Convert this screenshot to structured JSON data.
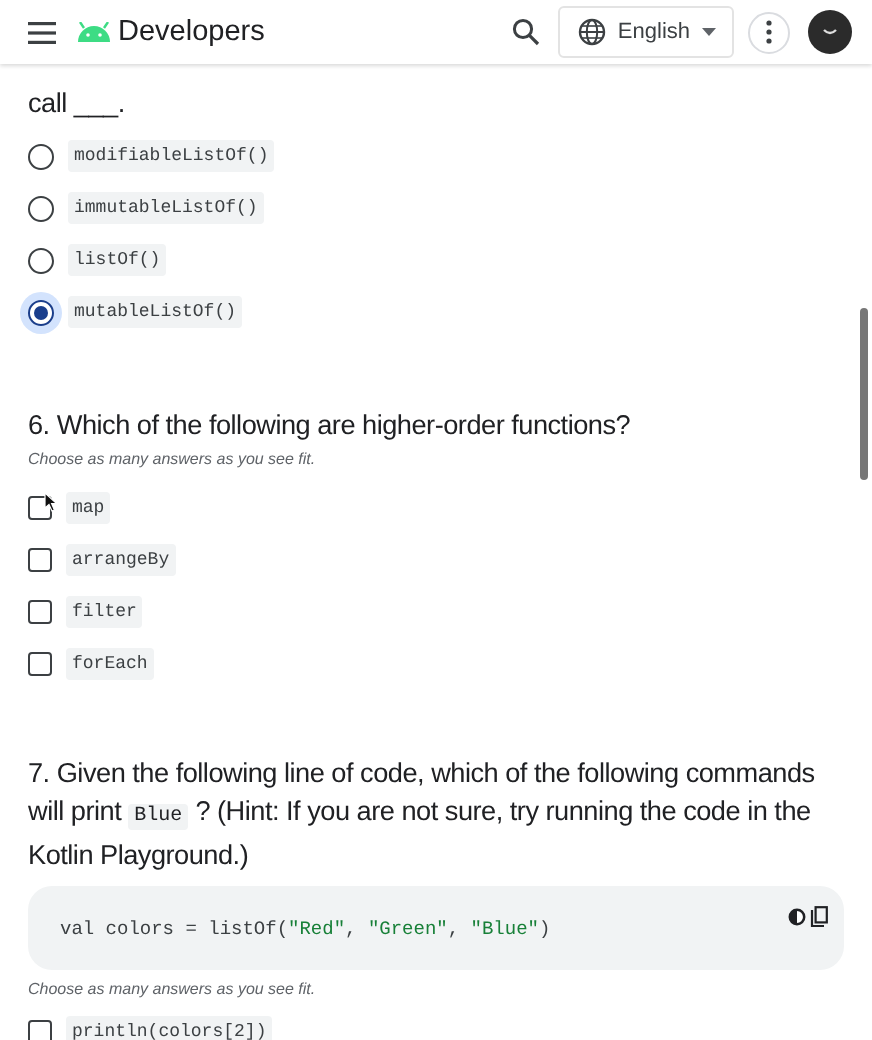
{
  "header": {
    "brand": "Developers",
    "language": "English"
  },
  "questions": [
    {
      "kind": "single",
      "parts": [
        {
          "kind": "text",
          "text": "call ___."
        }
      ],
      "options": [
        {
          "label": "modifiableListOf()",
          "selected": false
        },
        {
          "label": "immutableListOf()",
          "selected": false
        },
        {
          "label": "listOf()",
          "selected": false
        },
        {
          "label": "mutableListOf()",
          "selected": true
        }
      ]
    },
    {
      "kind": "multi",
      "parts": [
        {
          "kind": "text",
          "text": "6. Which of the following are higher-order functions?"
        }
      ],
      "hint": "Choose as many answers as you see fit.",
      "options": [
        {
          "label": "map",
          "checked": false
        },
        {
          "label": "arrangeBy",
          "checked": false
        },
        {
          "label": "filter",
          "checked": false
        },
        {
          "label": "forEach",
          "checked": false
        }
      ]
    },
    {
      "kind": "multi",
      "parts": [
        {
          "kind": "text",
          "text": "7. Given the following line of code, which of the following commands will print"
        },
        {
          "kind": "code",
          "text": "Blue"
        },
        {
          "kind": "text",
          "text": "? (Hint: If you are not sure, try running the code in the Kotlin Playground.)"
        }
      ],
      "code": [
        {
          "kind": "plain",
          "text": "val colors = listOf("
        },
        {
          "kind": "string",
          "text": "\"Red\""
        },
        {
          "kind": "plain",
          "text": ", "
        },
        {
          "kind": "string",
          "text": "\"Green\""
        },
        {
          "kind": "plain",
          "text": ", "
        },
        {
          "kind": "string",
          "text": "\"Blue\""
        },
        {
          "kind": "plain",
          "text": ")"
        }
      ],
      "hint": "Choose as many answers as you see fit.",
      "options": [
        {
          "label": "println(colors[2])",
          "checked": false
        }
      ]
    }
  ]
}
